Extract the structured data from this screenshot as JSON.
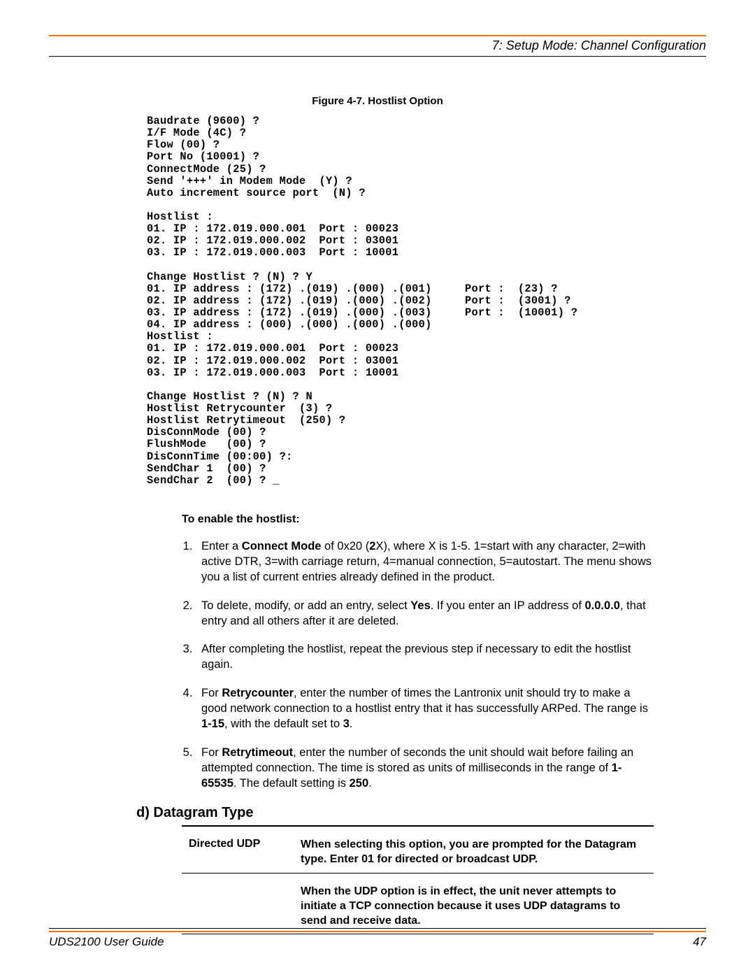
{
  "header": {
    "chapter": "7: Setup Mode: Channel Configuration"
  },
  "figure": {
    "caption": "Figure 4-7. Hostlist Option"
  },
  "terminal_lines": [
    "Baudrate (9600) ?",
    "I/F Mode (4C) ?",
    "Flow (00) ?",
    "Port No (10001) ?",
    "ConnectMode (25) ?",
    "Send '+++' in Modem Mode  (Y) ?",
    "Auto increment source port  (N) ?",
    "",
    "Hostlist :",
    "01. IP : 172.019.000.001  Port : 00023",
    "02. IP : 172.019.000.002  Port : 03001",
    "03. IP : 172.019.000.003  Port : 10001",
    "",
    "Change Hostlist ? (N) ? Y",
    "01. IP address : (172) .(019) .(000) .(001)     Port :  (23) ?",
    "02. IP address : (172) .(019) .(000) .(002)     Port :  (3001) ?",
    "03. IP address : (172) .(019) .(000) .(003)     Port :  (10001) ?",
    "04. IP address : (000) .(000) .(000) .(000)",
    "Hostlist :",
    "01. IP : 172.019.000.001  Port : 00023",
    "02. IP : 172.019.000.002  Port : 03001",
    "03. IP : 172.019.000.003  Port : 10001",
    "",
    "Change Hostlist ? (N) ? N",
    "Hostlist Retrycounter  (3) ?",
    "Hostlist Retrytimeout  (250) ?",
    "DisConnMode (00) ?",
    "FlushMode   (00) ?",
    "DisConnTime (00:00) ?:",
    "SendChar 1  (00) ?",
    "SendChar 2  (00) ? _"
  ],
  "enable_heading": "To enable the hostlist:",
  "steps": [
    {
      "pre": "Enter a ",
      "b1": "Connect Mode",
      "mid1": " of 0x20 (",
      "b2": "2",
      "mid2": "X), where X is 1-5. 1=start with any character, 2=with active DTR, 3=with carriage return, 4=manual connection, 5=autostart. The menu shows you a list of current entries already defined in the product."
    },
    {
      "pre": "To delete, modify, or add an entry, select ",
      "b1": "Yes",
      "mid1": ". If you enter an IP address of ",
      "b2": "0.0.0.0",
      "mid2": ", that entry and all others after it are deleted."
    },
    {
      "text": "After completing the hostlist, repeat the previous step if necessary to edit the hostlist again."
    },
    {
      "pre": "For ",
      "b1": "Retrycounter",
      "mid1": ", enter the number of times the Lantronix unit should try to make a good network connection to a hostlist entry that it has successfully ARPed. The range is ",
      "b2": "1-15",
      "mid2": ", with the default set to ",
      "b3": "3",
      "post": "."
    },
    {
      "pre": "For ",
      "b1": "Retrytimeout",
      "mid1": ", enter the number of seconds the unit should wait before failing an attempted connection. The time is stored as units of milliseconds in the range of ",
      "b2": "1-65535",
      "mid2": ". The default setting is ",
      "b3": "250",
      "post": "."
    }
  ],
  "datagram_heading": "d) Datagram Type",
  "table": {
    "left": "Directed UDP",
    "right1": "When selecting this option, you are prompted for the Datagram type. Enter 01 for directed or broadcast UDP.",
    "right2": "When the UDP option is in effect, the unit never attempts to initiate a TCP connection because it uses UDP datagrams to send and receive data."
  },
  "footer": {
    "title": "UDS2100 User Guide",
    "page": "47"
  }
}
